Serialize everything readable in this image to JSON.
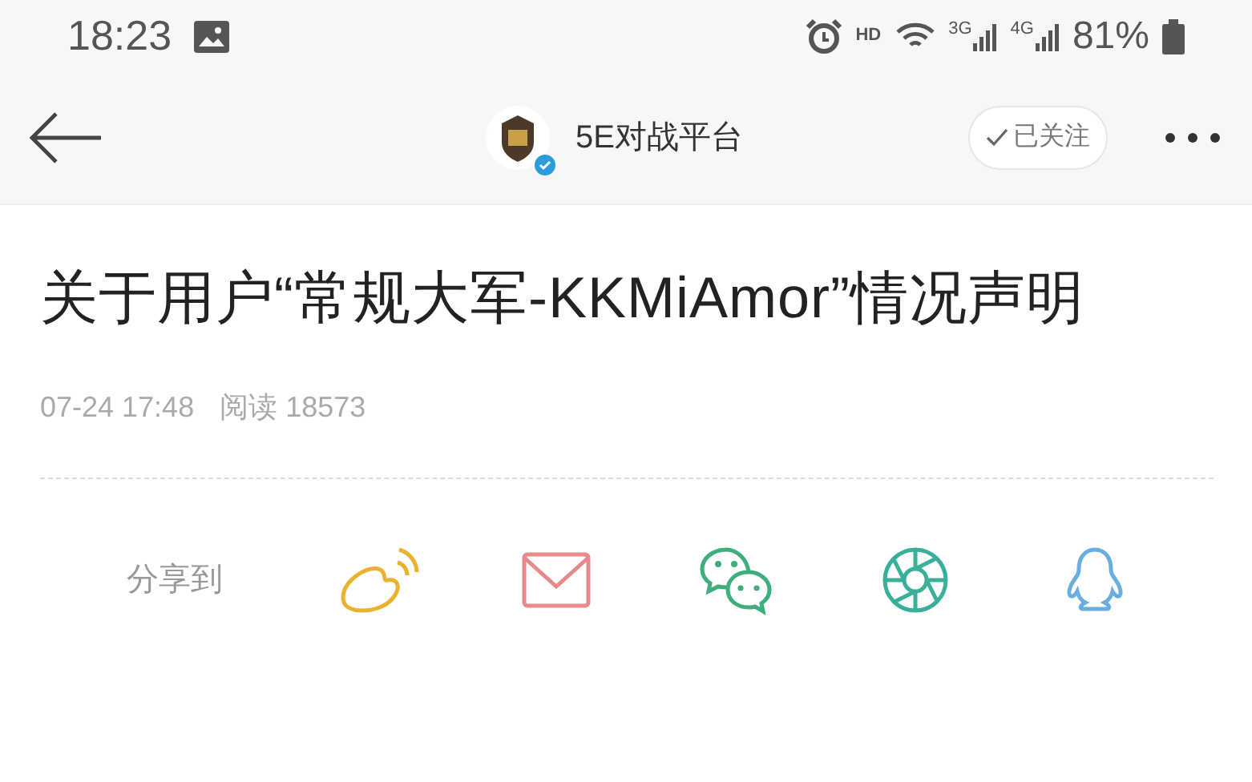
{
  "status_bar": {
    "time": "18:23",
    "hd": "HD",
    "networks": [
      "3G",
      "4G"
    ],
    "battery": "81%"
  },
  "header": {
    "account": "5E对战平台",
    "verified": true,
    "follow": {
      "label": "已关注",
      "followed": true
    }
  },
  "article": {
    "title": "关于用户“常规大军-KKMiAmor”情况声明",
    "date": "07-24 17:48",
    "reads_label": "阅读",
    "reads": "18573"
  },
  "share": {
    "label": "分享到",
    "targets": [
      {
        "kind": "weibo"
      },
      {
        "kind": "mail"
      },
      {
        "kind": "wechat"
      },
      {
        "kind": "moments"
      },
      {
        "kind": "qq"
      }
    ]
  }
}
